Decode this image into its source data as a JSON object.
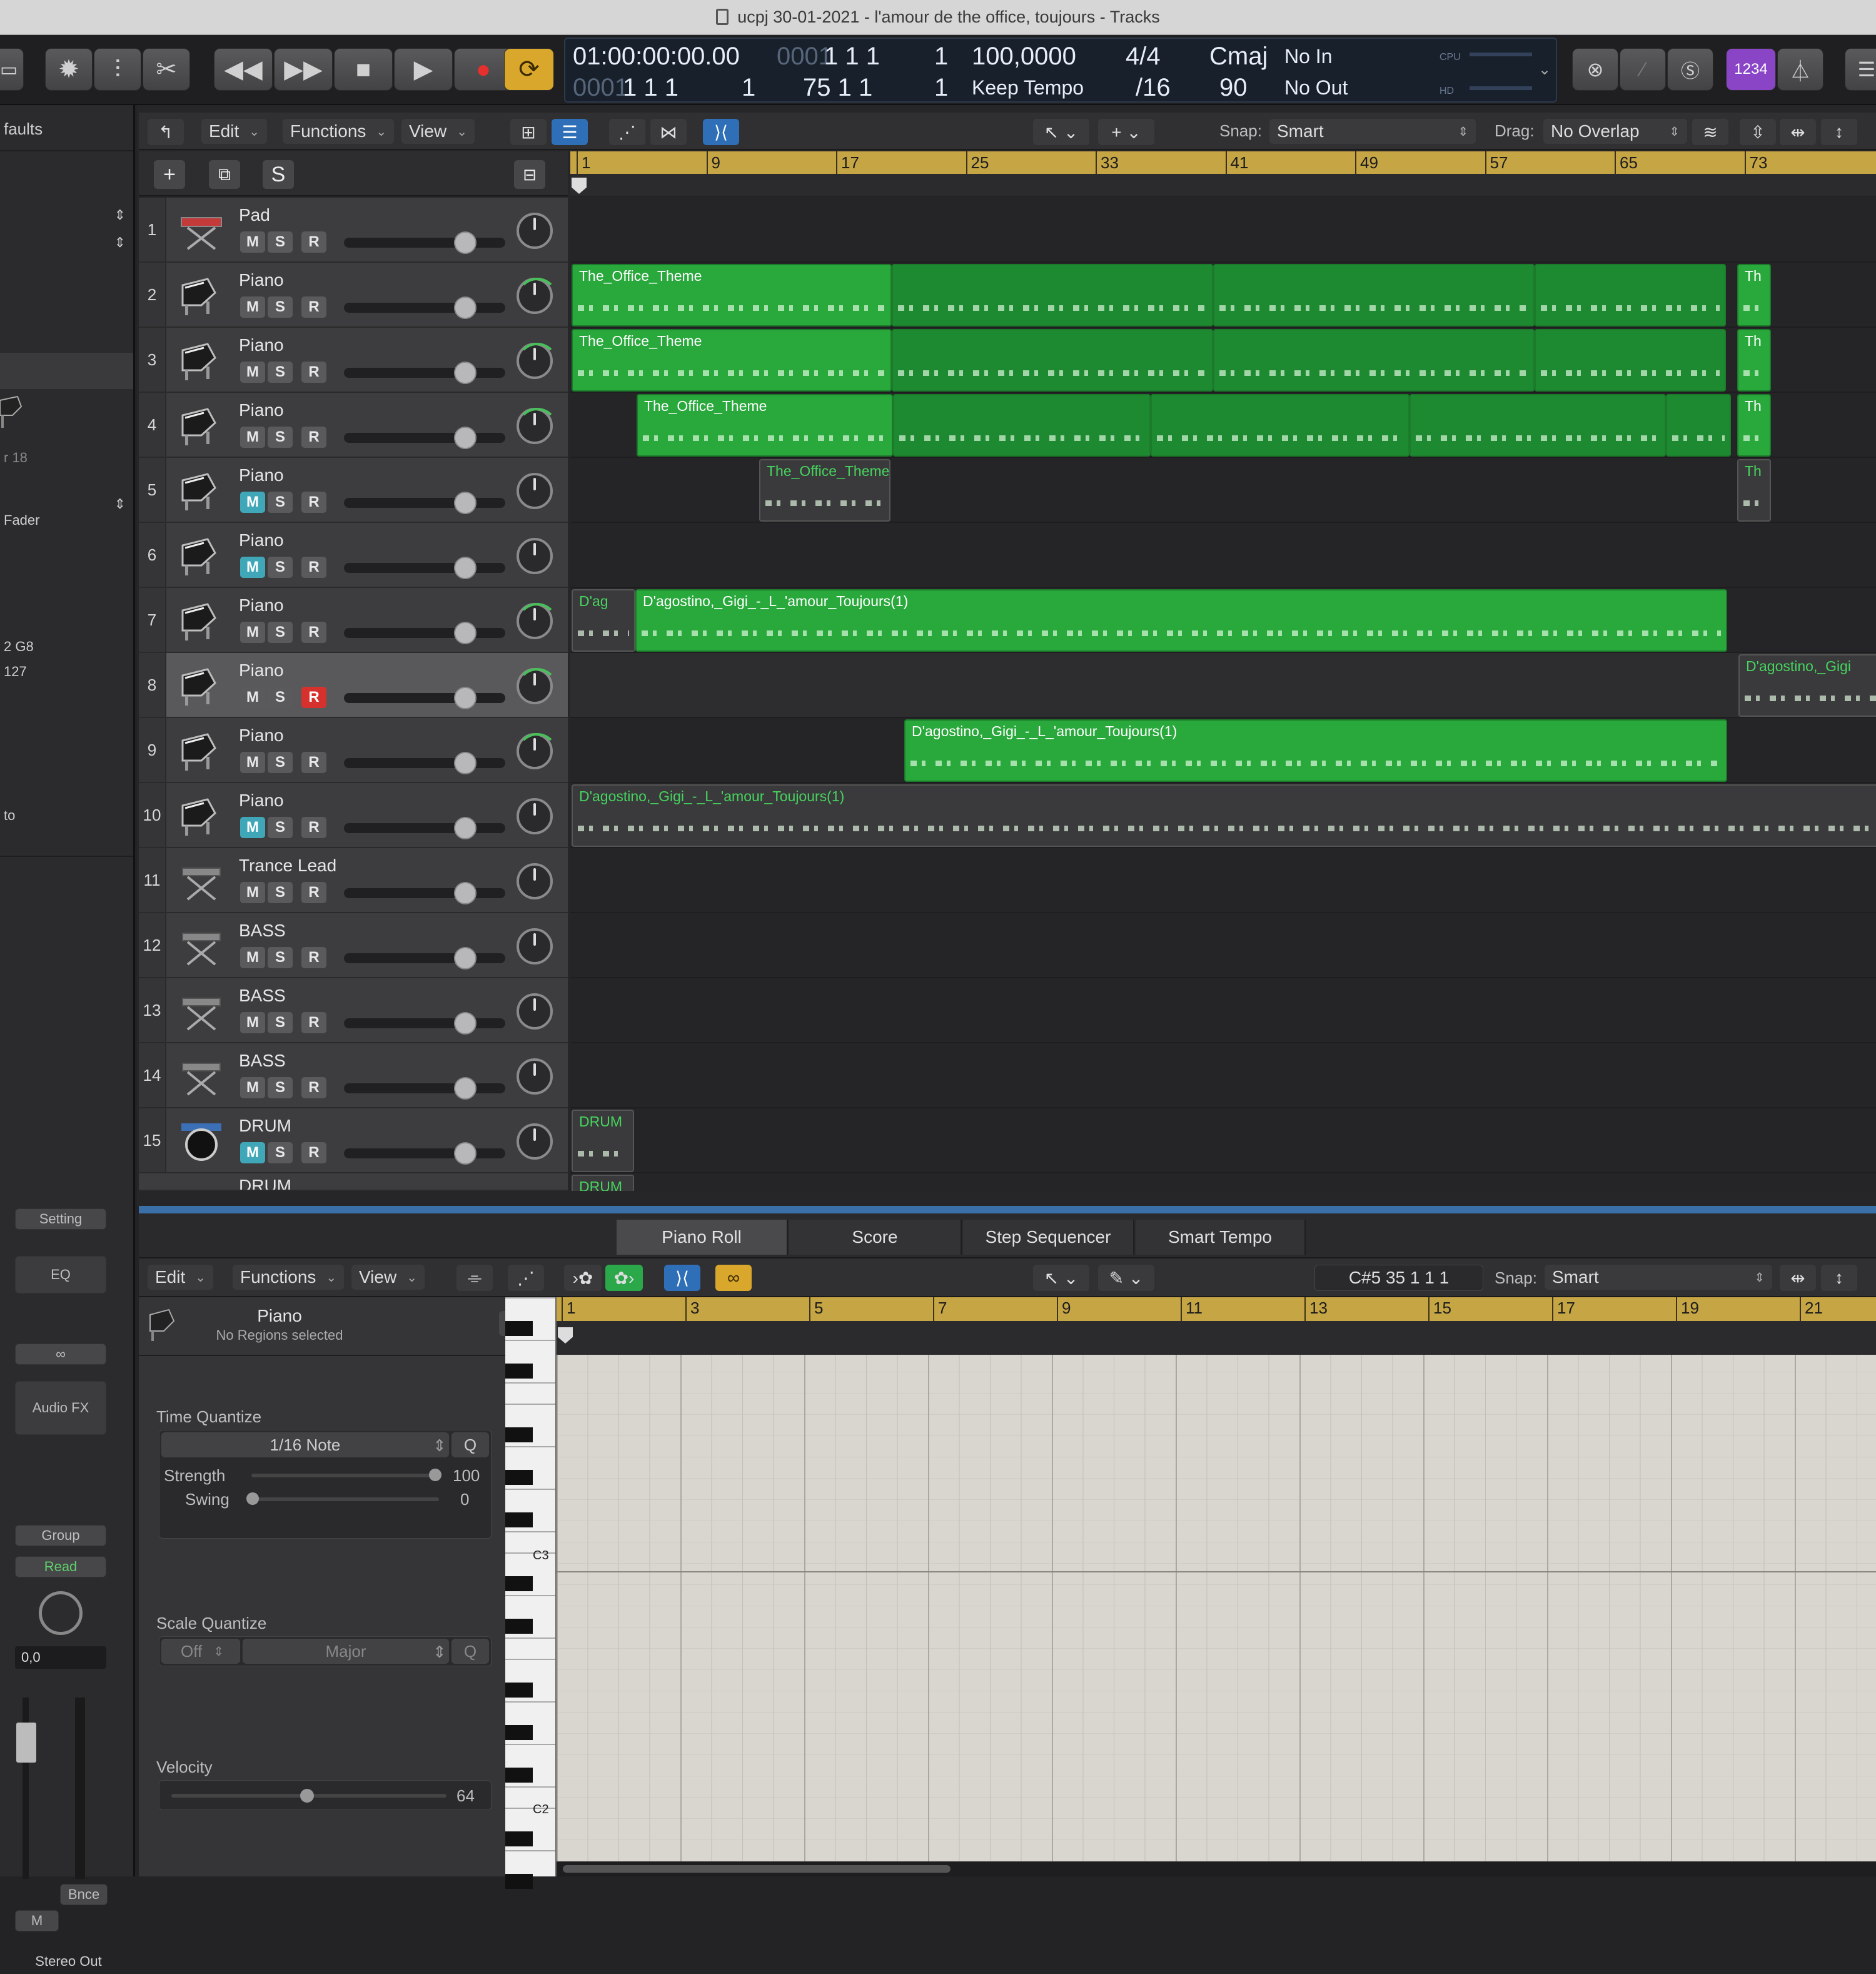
{
  "window": {
    "title": "ucpj 30-01-2021 - l'amour de the office, toujours - Tracks"
  },
  "lcd": {
    "timecode": "01:00:00:00.00",
    "bars_top": "1   1   1",
    "sub_top": "1",
    "bars_left": "0001",
    "bars_bottom": "1   1   1",
    "sub_bottom": "1",
    "end_bars": "75   1   1",
    "end_sub": "1",
    "tempo": "100,0000",
    "tempo_mode": "Keep Tempo",
    "sig": "4/4",
    "div": "/16",
    "key": "Cmaj",
    "key_num": "90",
    "in": "No In",
    "out": "No Out",
    "cpu": "CPU",
    "hd": "HD",
    "count_in": "1234"
  },
  "track_toolbar": {
    "edit": "Edit",
    "functions": "Functions",
    "view": "View",
    "snap_label": "Snap:",
    "snap_value": "Smart",
    "drag_label": "Drag:",
    "drag_value": "No Overlap"
  },
  "inspector": {
    "faults": "faults",
    "r18": "r 18",
    "fader": "Fader",
    "g8": "2  G8",
    "n127": "127",
    "to": "to",
    "setting": "Setting",
    "eq": "EQ",
    "link": "∞",
    "audio_fx": "Audio FX",
    "group": "Group",
    "read": "Read",
    "pan_value": "0,0",
    "bnce": "Bnce",
    "m": "M",
    "stereo_out": "Stereo Out"
  },
  "ruler": [
    "1",
    "9",
    "17",
    "25",
    "33",
    "41",
    "49",
    "57",
    "65",
    "73"
  ],
  "tracks": [
    {
      "num": "1",
      "name": "Pad",
      "icon": "keyboard-icon"
    },
    {
      "num": "2",
      "name": "Piano",
      "icon": "grand-piano-icon"
    },
    {
      "num": "3",
      "name": "Piano",
      "icon": "grand-piano-icon"
    },
    {
      "num": "4",
      "name": "Piano",
      "icon": "grand-piano-icon"
    },
    {
      "num": "5",
      "name": "Piano",
      "icon": "grand-piano-icon"
    },
    {
      "num": "6",
      "name": "Piano",
      "icon": "grand-piano-icon"
    },
    {
      "num": "7",
      "name": "Piano",
      "icon": "grand-piano-icon"
    },
    {
      "num": "8",
      "name": "Piano",
      "icon": "grand-piano-icon"
    },
    {
      "num": "9",
      "name": "Piano",
      "icon": "grand-piano-icon"
    },
    {
      "num": "10",
      "name": "Piano",
      "icon": "grand-piano-icon"
    },
    {
      "num": "11",
      "name": "Trance Lead",
      "icon": "synth-icon"
    },
    {
      "num": "12",
      "name": "BASS",
      "icon": "synth-icon"
    },
    {
      "num": "13",
      "name": "BASS",
      "icon": "synth-icon"
    },
    {
      "num": "14",
      "name": "BASS",
      "icon": "synth-icon"
    },
    {
      "num": "15",
      "name": "DRUM",
      "icon": "drum-icon"
    }
  ],
  "msr": {
    "m": "M",
    "s": "S",
    "r": "R"
  },
  "regions": {
    "office": "The_Office_Theme",
    "th": "Th",
    "dag": "D'agostino,_Gigi_-_L_'amour_Toujours(1)",
    "dag_short": "D'ag",
    "dag_gigi": "D'agostino,_Gigi",
    "drum": "DRUM"
  },
  "editor": {
    "tabs": [
      "Piano Roll",
      "Score",
      "Step Sequencer",
      "Smart Tempo"
    ],
    "edit": "Edit",
    "functions": "Functions",
    "view": "View",
    "position": "C#5  35 1 1 1",
    "snap_label": "Snap:",
    "snap_value": "Smart",
    "track_name": "Piano",
    "region_info": "No Regions selected",
    "time_quantize": "Time Quantize",
    "quantize_value": "1/16 Note",
    "q": "Q",
    "strength": "Strength",
    "strength_value": "100",
    "swing": "Swing",
    "swing_value": "0",
    "scale_quantize": "Scale Quantize",
    "scale_off": "Off",
    "scale_major": "Major",
    "velocity": "Velocity",
    "velocity_value": "64",
    "c3": "C3",
    "c2": "C2"
  },
  "pr_ruler": [
    "1",
    "3",
    "5",
    "7",
    "9",
    "11",
    "13",
    "15",
    "17",
    "19",
    "21"
  ]
}
